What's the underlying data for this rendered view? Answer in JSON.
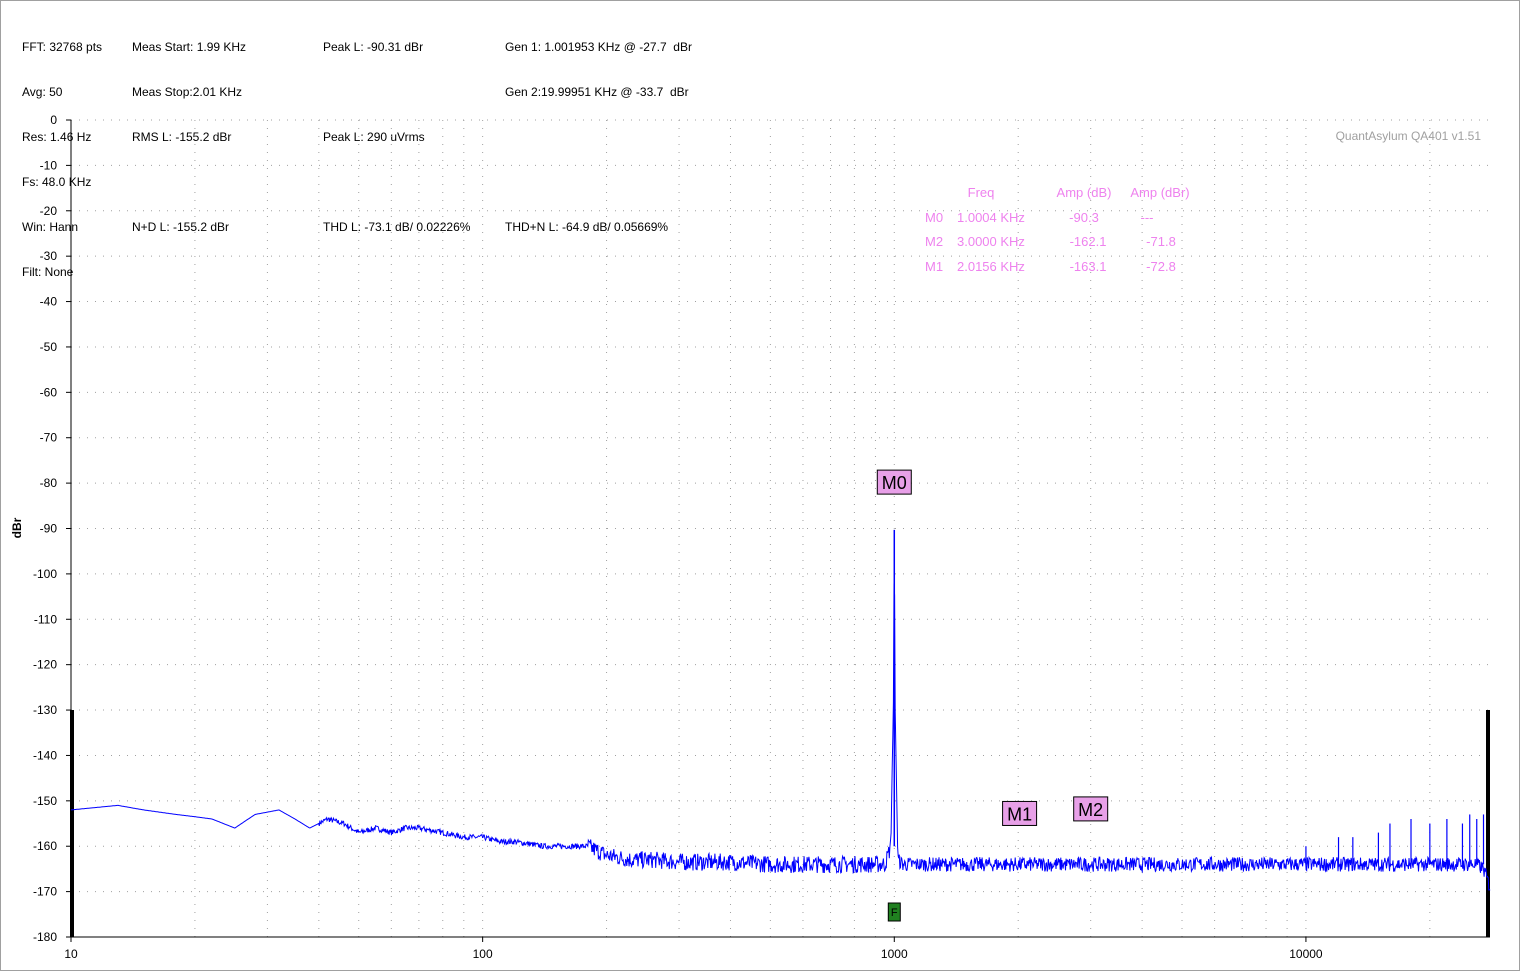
{
  "info": {
    "col1": [
      "FFT: 32768 pts",
      "Avg: 50",
      "Res: 1.46 Hz",
      "Fs: 48.0 KHz",
      "Win: Hann",
      "Filt: None"
    ],
    "col2": [
      "Meas Start: 1.99 KHz",
      "Meas Stop:2.01 KHz",
      "RMS L: -155.2 dBr",
      "",
      "N+D L: -155.2 dBr"
    ],
    "col3": [
      "Peak L: -90.31 dBr",
      "",
      "Peak L: 290 uVrms",
      "",
      "THD L: -73.1 dB/ 0.02226%"
    ],
    "col4": [
      "Gen 1: 1.001953 KHz @ -27.7  dBr",
      "Gen 2:19.99951 KHz @ -33.7  dBr",
      "",
      "",
      "THD+N L: -64.9 dB/ 0.05669%"
    ]
  },
  "watermark": "QuantAsylum QA401 v1.51",
  "marker_table": {
    "headers": [
      "Freq",
      "Amp (dB)",
      "Amp (dBr)"
    ],
    "rows": [
      {
        "name": "M0",
        "freq": "1.0004 KHz",
        "amp_db": "-90.3",
        "amp_dbr": "---"
      },
      {
        "name": "M2",
        "freq": "3.0000 KHz",
        "amp_db": "-162.1",
        "amp_dbr": "-71.8"
      },
      {
        "name": "M1",
        "freq": "2.0156 KHz",
        "amp_db": "-163.1",
        "amp_dbr": "-72.8"
      }
    ]
  },
  "colors": {
    "trace": "#0000ff",
    "marker_text": "#ee82ee",
    "marker_box": "#e8a0e8",
    "f_box": "#208020",
    "grid": "#a0a0a0"
  },
  "chart_data": {
    "type": "line",
    "xscale": "log",
    "xlim": [
      10,
      28000
    ],
    "ylim": [
      -180,
      0
    ],
    "ylabel": "dBr",
    "xlabel": "",
    "x_ticks": [
      10,
      100,
      1000,
      10000
    ],
    "x_tick_labels": [
      "10",
      "100",
      "1000",
      "10000"
    ],
    "y_ticks": [
      0,
      -10,
      -20,
      -30,
      -40,
      -50,
      -60,
      -70,
      -80,
      -90,
      -100,
      -110,
      -120,
      -130,
      -140,
      -150,
      -160,
      -170,
      -180
    ],
    "grid": true,
    "series": [
      {
        "x": [
          10,
          13,
          15,
          18,
          20,
          22,
          25,
          28,
          32,
          35,
          38,
          42,
          46,
          50,
          55,
          60,
          65,
          70,
          80,
          90,
          100,
          110,
          120,
          140,
          160,
          180,
          200,
          230,
          260,
          300,
          400,
          500,
          600,
          700,
          800,
          900,
          950,
          980,
          995,
          1000,
          1005,
          1020,
          1050,
          1100,
          1500,
          2000,
          3000,
          5000,
          8000,
          10000,
          12000,
          13000,
          15000,
          17000,
          18000,
          20000,
          22000,
          24000,
          25000,
          26000,
          27000,
          27500,
          28000
        ],
        "y": [
          -152,
          -151,
          -152,
          -153,
          -153.5,
          -154,
          -156,
          -153,
          -152,
          -154,
          -156,
          -154,
          -155,
          -157,
          -156,
          -157,
          -156,
          -156,
          -157,
          -158,
          -158,
          -159,
          -159,
          -160,
          -160,
          -160,
          -162,
          -163,
          -163,
          -163.5,
          -163.5,
          -164,
          -164,
          -164,
          -164,
          -164,
          -164,
          -160,
          -130,
          -90.3,
          -130,
          -163,
          -164,
          -164,
          -164,
          -164,
          -164,
          -164,
          -164,
          -164,
          -164,
          -164,
          -164,
          -164,
          -164,
          -164,
          -164,
          -164,
          -164,
          -164,
          -165,
          -167,
          -169
        ]
      }
    ],
    "spurs": [
      {
        "x": 10000,
        "y": -160
      },
      {
        "x": 12000,
        "y": -158
      },
      {
        "x": 13000,
        "y": -158
      },
      {
        "x": 15000,
        "y": -157
      },
      {
        "x": 16000,
        "y": -155
      },
      {
        "x": 18000,
        "y": -154
      },
      {
        "x": 20000,
        "y": -155
      },
      {
        "x": 22000,
        "y": -154
      },
      {
        "x": 24000,
        "y": -155
      },
      {
        "x": 25000,
        "y": -153
      },
      {
        "x": 26000,
        "y": -154
      },
      {
        "x": 27000,
        "y": -153
      }
    ],
    "markers": [
      {
        "name": "M0",
        "x": 1000,
        "y": -80
      },
      {
        "name": "M1",
        "x": 2015.6,
        "y": -153
      },
      {
        "name": "M2",
        "x": 3000,
        "y": -152
      }
    ],
    "f_marker": {
      "label": "F",
      "x": 1000
    }
  }
}
